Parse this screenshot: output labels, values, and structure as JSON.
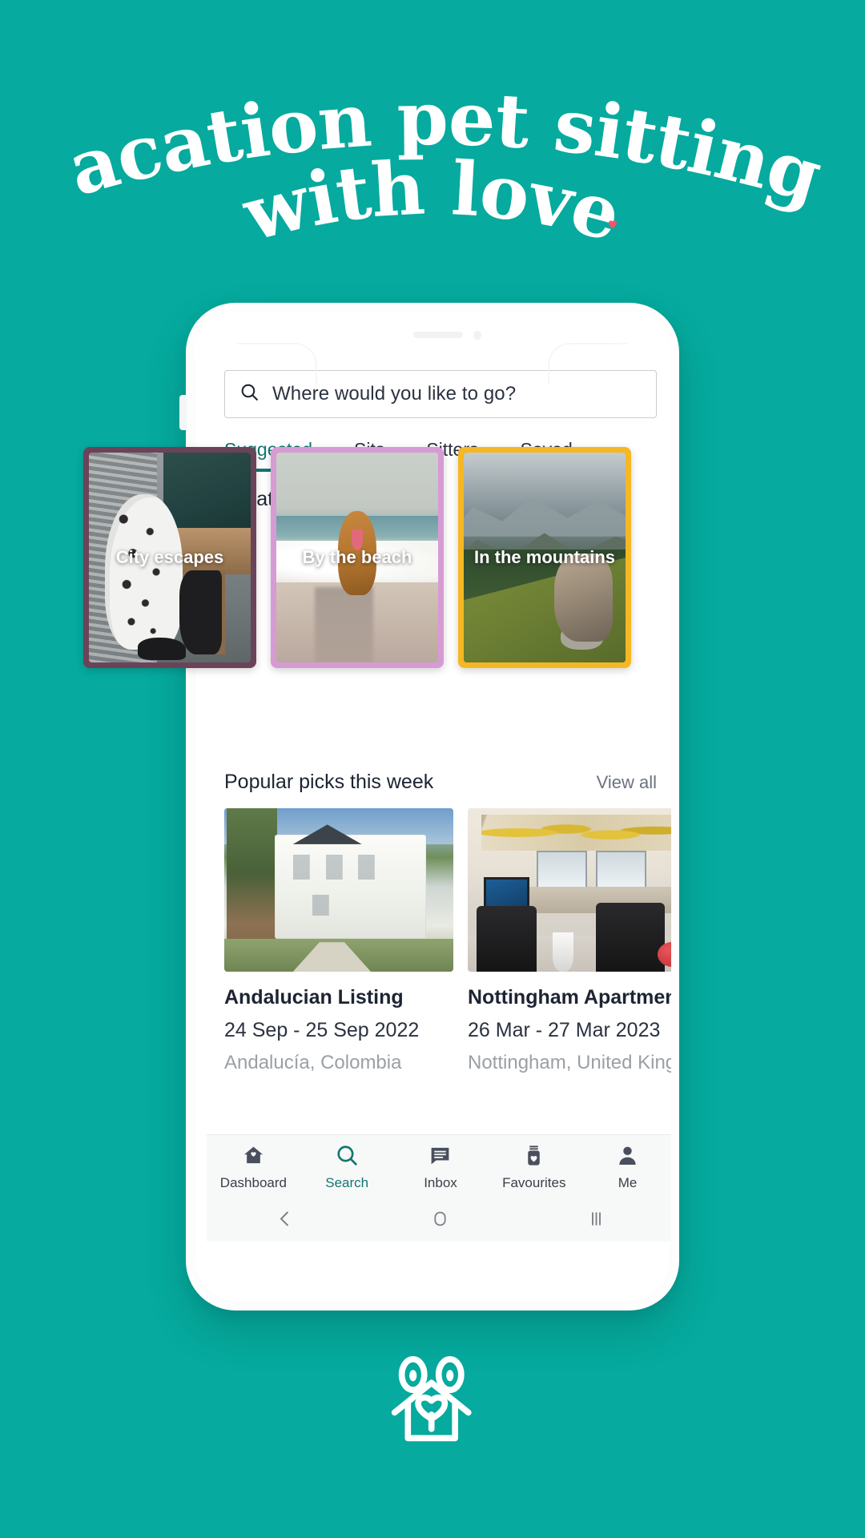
{
  "theme": {
    "background": "#06aa9e",
    "accent": "#12786f",
    "heart": "#f4556a"
  },
  "headline": {
    "line1": "Vacation pet sitting,",
    "line2": "with love",
    "heart_icon": "heart-dot-icon"
  },
  "app": {
    "search": {
      "icon": "search-icon",
      "placeholder": "Where would you like to go?",
      "value": ""
    },
    "tabs": [
      {
        "label": "Suggested",
        "active": true
      },
      {
        "label": "Sits",
        "active": false
      },
      {
        "label": "Sitters",
        "active": false
      },
      {
        "label": "Saved",
        "active": false
      }
    ],
    "location_inspiration": {
      "title": "Location inspiration",
      "cards": [
        {
          "label": "City escapes",
          "border_color": "#6b4359"
        },
        {
          "label": "By the beach",
          "border_color": "#d79bd4"
        },
        {
          "label": "In the mountains",
          "border_color": "#f5b723"
        }
      ]
    },
    "popular_picks": {
      "title": "Popular picks this week",
      "view_all": "View all",
      "items": [
        {
          "title": "Andalucian Listing",
          "dates": "24 Sep - 25 Sep 2022",
          "location": "Andalucía, Colombia"
        },
        {
          "title": "Nottingham Apartment",
          "dates": "26 Mar - 27 Mar 2023",
          "location": "Nottingham, United Kingdom"
        }
      ]
    },
    "bottom_nav": [
      {
        "label": "Dashboard",
        "icon": "house-heart-icon",
        "active": false
      },
      {
        "label": "Search",
        "icon": "search-icon",
        "active": true
      },
      {
        "label": "Inbox",
        "icon": "chat-bubble-icon",
        "active": false
      },
      {
        "label": "Favourites",
        "icon": "jar-heart-icon",
        "active": false
      },
      {
        "label": "Me",
        "icon": "person-icon",
        "active": false
      }
    ],
    "system_nav": [
      {
        "icon": "back-chevron-icon"
      },
      {
        "icon": "home-square-icon"
      },
      {
        "icon": "recents-bars-icon"
      }
    ]
  },
  "footer": {
    "logo_icon": "house-pet-heart-logo"
  }
}
